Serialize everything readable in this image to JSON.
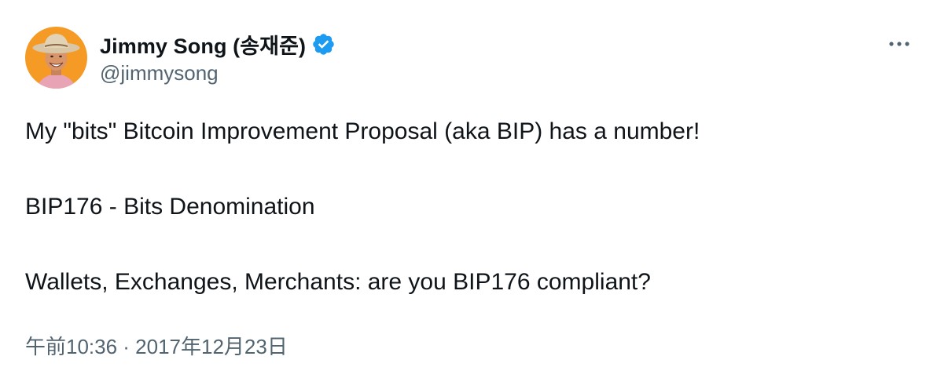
{
  "author": {
    "display_name": "Jimmy Song (송재준)",
    "handle": "@jimmysong",
    "verified": true
  },
  "tweet": {
    "lines": [
      "My \"bits\" Bitcoin Improvement Proposal (aka BIP) has a number!",
      "BIP176 - Bits Denomination",
      "Wallets, Exchanges, Merchants: are you BIP176 compliant?"
    ],
    "timestamp": "午前10:36 · 2017年12月23日"
  },
  "icons": {
    "verified": "verified-badge-icon",
    "more": "more-options-icon"
  },
  "colors": {
    "text_primary": "#0f1419",
    "text_secondary": "#536471",
    "verified_blue": "#1d9bf0",
    "avatar_background": "#f49a25"
  }
}
